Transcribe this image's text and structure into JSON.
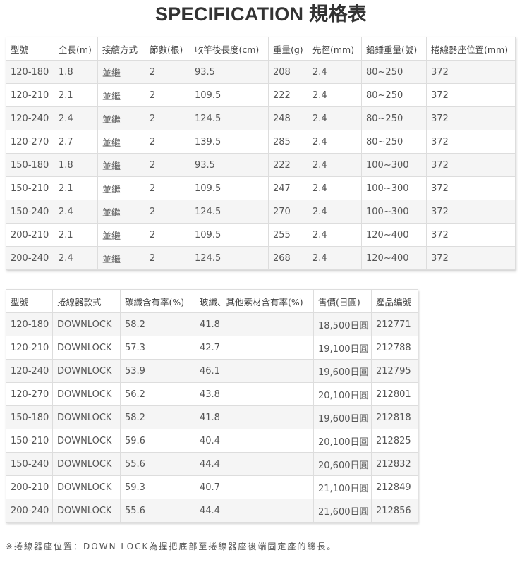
{
  "title": "SPECIFICATION 規格表",
  "table1": {
    "headers": [
      "型號",
      "全長(m)",
      "接續方式",
      "節數(根)",
      "收竿後長度(cm)",
      "重量(g)",
      "先徑(mm)",
      "鉛錘重量(號)",
      "捲線器座位置(mm)"
    ],
    "rows": [
      [
        "120-180",
        "1.8",
        "並繼",
        "2",
        "93.5",
        "208",
        "2.4",
        "80~250",
        "372"
      ],
      [
        "120-210",
        "2.1",
        "並繼",
        "2",
        "109.5",
        "222",
        "2.4",
        "80~250",
        "372"
      ],
      [
        "120-240",
        "2.4",
        "並繼",
        "2",
        "124.5",
        "248",
        "2.4",
        "80~250",
        "372"
      ],
      [
        "120-270",
        "2.7",
        "並繼",
        "2",
        "139.5",
        "285",
        "2.4",
        "80~250",
        "372"
      ],
      [
        "150-180",
        "1.8",
        "並繼",
        "2",
        "93.5",
        "222",
        "2.4",
        "100~300",
        "372"
      ],
      [
        "150-210",
        "2.1",
        "並繼",
        "2",
        "109.5",
        "247",
        "2.4",
        "100~300",
        "372"
      ],
      [
        "150-240",
        "2.4",
        "並繼",
        "2",
        "124.5",
        "270",
        "2.4",
        "100~300",
        "372"
      ],
      [
        "200-210",
        "2.1",
        "並繼",
        "2",
        "109.5",
        "255",
        "2.4",
        "120~400",
        "372"
      ],
      [
        "200-240",
        "2.4",
        "並繼",
        "2",
        "124.5",
        "268",
        "2.4",
        "120~400",
        "372"
      ]
    ]
  },
  "table2": {
    "headers": [
      "型號",
      "捲線器款式",
      "碳纖含有率(%)",
      "玻纖、其他素材含有率(%)",
      "售價(日圓)",
      "產品編號"
    ],
    "rows": [
      [
        "120-180",
        "DOWNLOCK",
        "58.2",
        "41.8",
        "18,500日圓",
        "212771"
      ],
      [
        "120-210",
        "DOWNLOCK",
        "57.3",
        "42.7",
        "19,100日圓",
        "212788"
      ],
      [
        "120-240",
        "DOWNLOCK",
        "53.9",
        "46.1",
        "19,600日圓",
        "212795"
      ],
      [
        "120-270",
        "DOWNLOCK",
        "56.2",
        "43.8",
        "20,100日圓",
        "212801"
      ],
      [
        "150-180",
        "DOWNLOCK",
        "58.2",
        "41.8",
        "19,600日圓",
        "212818"
      ],
      [
        "150-210",
        "DOWNLOCK",
        "59.6",
        "40.4",
        "20,100日圓",
        "212825"
      ],
      [
        "150-240",
        "DOWNLOCK",
        "55.6",
        "44.4",
        "20,600日圓",
        "212832"
      ],
      [
        "200-210",
        "DOWNLOCK",
        "59.3",
        "40.7",
        "21,100日圓",
        "212849"
      ],
      [
        "200-240",
        "DOWNLOCK",
        "55.6",
        "44.4",
        "21,600日圓",
        "212856"
      ]
    ]
  },
  "footnote": "※捲線器座位置：DOWN LOCK為握把底部至捲線器座後端固定座的總長。"
}
